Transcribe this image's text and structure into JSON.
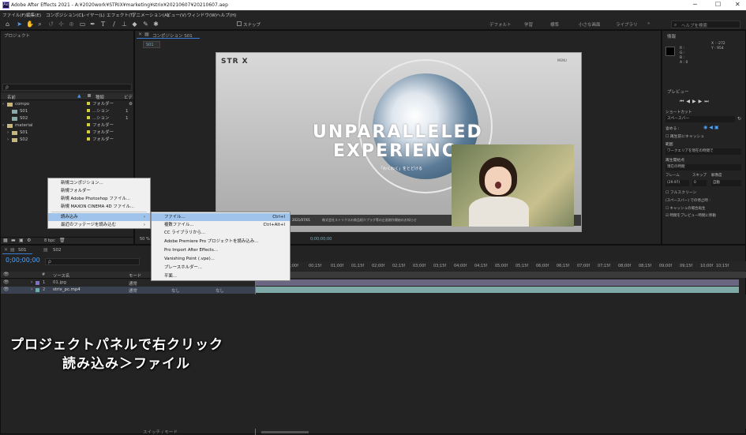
{
  "title_bar": {
    "app_icon": "Ae",
    "title": "Adobe After Effects 2021 - A:¥2020work¥STRIX¥marketing¥strix¥20210607¥20210607.aep",
    "minimize": "─",
    "maximize": "☐",
    "close": "✕"
  },
  "menu": [
    "ファイル(F)",
    "編集(E)",
    "コンポジション(C)",
    "レイヤー(L)",
    "エフェクト(T)",
    "アニメーション(A)",
    "ビュー(V)",
    "ウィンドウ(W)",
    "ヘルプ(H)"
  ],
  "toolbar": {
    "snap_label": "スナップ",
    "workspaces": [
      "デフォルト",
      "学習",
      "標準",
      "小さな画面",
      "ライブラリ"
    ],
    "more": "»",
    "search_placeholder": "ヘルプを検索"
  },
  "project_panel": {
    "tab": "プロジェクト",
    "search_placeholder": "ρ",
    "columns": {
      "name": "名前",
      "label_col": "",
      "type": "種類",
      "extra": "ビデ"
    },
    "items": [
      {
        "name": "compo",
        "type": "フォルダー",
        "indent": 0,
        "kind": "folder"
      },
      {
        "name": "S01",
        "type": "...ション",
        "indent": 1,
        "kind": "comp",
        "extra": "1"
      },
      {
        "name": "S02",
        "type": "...ション",
        "indent": 1,
        "kind": "comp",
        "extra": "1"
      },
      {
        "name": "material",
        "type": "フォルダー",
        "indent": 0,
        "kind": "folder"
      },
      {
        "name": "S01",
        "type": "フォルダー",
        "indent": 1,
        "kind": "folder"
      },
      {
        "name": "S02",
        "type": "フォルダー",
        "indent": 1,
        "kind": "folder"
      }
    ],
    "bpc": "8 bpc"
  },
  "comp_panel": {
    "tab": "コンポジション S01",
    "sub_tab": "S01",
    "zoom": "50 %",
    "timecode": "0;00;00;00",
    "video": {
      "logo": "STR X",
      "menu_text": "MENU",
      "headline1": "UNPARALLELED",
      "headline2": "EXPERIENC",
      "tagline": "「わくわく」をとどける",
      "side_text": "SCROLL TO EXPLORE",
      "date": "2021/07/01",
      "news": "株式会社ストリクスの商品紹介プラグ等の企画制作開始のお知らせ"
    }
  },
  "context_menu": {
    "items": [
      "新規コンポジション...",
      "新規フォルダー",
      "新規 Adobe Photoshop ファイル...",
      "新規 MAXON CINEMA 4D ファイル...",
      "読み込み",
      "最近のフッテージを読み込む"
    ],
    "arrow": "›"
  },
  "submenu": {
    "items": [
      {
        "label": "ファイル...",
        "shortcut": "Ctrl+I"
      },
      {
        "label": "複数ファイル...",
        "shortcut": "Ctrl+Alt+I"
      },
      {
        "label": "CC ライブラリから...",
        "shortcut": ""
      },
      {
        "label": "Adobe Premiere Pro プロジェクトを読み込み...",
        "shortcut": ""
      },
      {
        "label": "Pro Import After Effects...",
        "shortcut": ""
      },
      {
        "label": "Vanishing Point (.vpe)...",
        "shortcut": ""
      },
      {
        "label": "プレースホルダー...",
        "shortcut": ""
      },
      {
        "label": "平面...",
        "shortcut": ""
      }
    ]
  },
  "right_panel": {
    "info_tab": "情報",
    "info_x": "X : -272",
    "info_y": "Y : 954",
    "info_r": "R :",
    "info_g": "G :",
    "info_b": "B :",
    "info_a": "A : 0",
    "preview_tab": "プレビュー",
    "shortcut_label": "ショートカット",
    "shortcut_value": "スペースバー",
    "include_label": "含める :",
    "cache_label": "再生前にキャッシュ",
    "range_label": "範囲",
    "range_value": "ワークエリアを現在の時間で",
    "start_label": "再生開始点",
    "start_value": "現在の時間",
    "fps_label": "フレーム",
    "skip_label": "スキップ",
    "res_label": "解像度",
    "fps_value": "(29.97)",
    "skip_value": "0",
    "res_value": "自動",
    "fullscreen_label": "フルスクリーン",
    "stop_label": "(スペースバー) での停止時 :",
    "stop_opt1": "キャッシュの場合再生",
    "stop_opt2": "時間をプレビュー時間に移動"
  },
  "timeline": {
    "tabs": [
      "S01",
      "S02"
    ],
    "timecode": "0;00;00;00",
    "search_placeholder": "ρ",
    "columns": {
      "num": "#",
      "source": "ソース名",
      "mode": "モード",
      "t": "T",
      "trkmat": "TrkMat",
      "parent": "親とリンク"
    },
    "layers": [
      {
        "num": "1",
        "name": "01.jpg",
        "mode": "通常",
        "trk": "なし",
        "parent": "なし"
      },
      {
        "num": "2",
        "name": "strix_pc.mp4",
        "mode": "通常",
        "trk": "なし",
        "parent": "なし"
      }
    ],
    "ruler": [
      "0;00f",
      "00;15f",
      "01;00f",
      "01;15f",
      "02;00f",
      "02;15f",
      "03;00f",
      "03;15f",
      "04;00f",
      "04;15f",
      "05;00f",
      "05;15f",
      "06;00f",
      "06;15f",
      "07;00f",
      "07;15f",
      "08;00f",
      "08;15f",
      "09;00f",
      "09;15f",
      "10;00f",
      "10;15f",
      "11;00f",
      "11;15f"
    ],
    "switch_mode": "スイッチ / モード"
  },
  "overlay": {
    "line1": "プロジェクトパネルで右クリック",
    "line2": "読み込み＞ファイル"
  }
}
